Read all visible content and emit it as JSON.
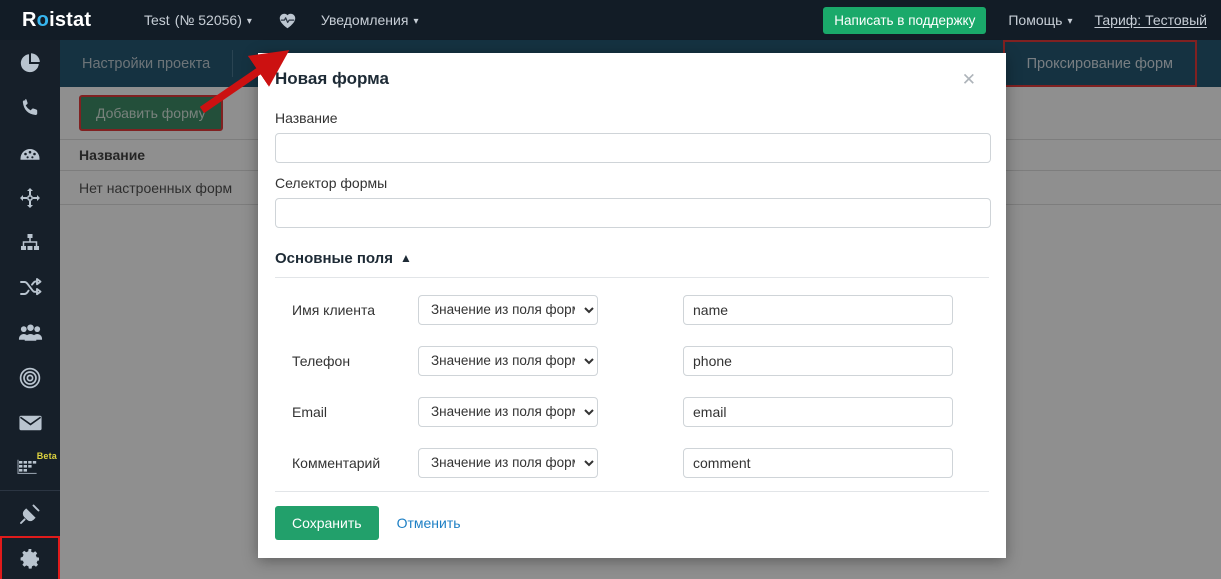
{
  "topbar": {
    "logo_text_before": "R",
    "logo_dot": "o",
    "logo_text_after": "istat",
    "project": "Test",
    "project_number": "(№ 52056)",
    "pulse_icon": "heartbeat-icon",
    "notifications": "Уведомления",
    "support_button": "Написать в поддержку",
    "help": "Помощь",
    "tariff": "Тариф: Тестовый",
    "accent_green": "#1aa96a",
    "bar_color": "#121c26"
  },
  "sidebar": {
    "items": [
      {
        "name": "analytics",
        "icon": "pie-chart-icon"
      },
      {
        "name": "calls",
        "icon": "phone-icon"
      },
      {
        "name": "dashboard",
        "icon": "gauge-icon"
      },
      {
        "name": "multichannel",
        "icon": "arrows-move-icon"
      },
      {
        "name": "funnel",
        "icon": "sitemap-icon"
      },
      {
        "name": "distribution",
        "icon": "shuffle-icon"
      },
      {
        "name": "leads",
        "icon": "users-icon"
      },
      {
        "name": "targets",
        "icon": "target-icon"
      },
      {
        "name": "mail",
        "icon": "envelope-icon"
      },
      {
        "name": "tables",
        "icon": "table-grid-icon",
        "badge": "Beta"
      },
      {
        "name": "integrations",
        "icon": "plug-icon"
      },
      {
        "name": "settings",
        "icon": "gear-icon",
        "highlighted": true
      }
    ],
    "highlight_color": "#e01b1b"
  },
  "subnav": {
    "project_settings": "Настройки проекта",
    "forms_proxy_tab": "Проксирование форм",
    "bar_color": "#023e5c"
  },
  "page": {
    "add_form_button": "Добавить форму",
    "table": {
      "columns": [
        "Название"
      ],
      "rows": [
        [
          "Нет настроенных форм"
        ]
      ]
    }
  },
  "modal": {
    "title": "Новая форма",
    "close_icon": "close-icon",
    "name_label": "Название",
    "name_value": "",
    "name_placeholder": "",
    "selector_label": "Селектор формы",
    "selector_value": "",
    "selector_placeholder": "",
    "section_title": "Основные поля",
    "section_chevron": "⌃",
    "select_option": "Значение из поля формы",
    "fields": [
      {
        "label": "Имя клиента",
        "source": "Значение из поля формы",
        "value": "name"
      },
      {
        "label": "Телефон",
        "source": "Значение из поля формы",
        "value": "phone"
      },
      {
        "label": "Email",
        "source": "Значение из поля формы",
        "value": "email"
      },
      {
        "label": "Комментарий",
        "source": "Значение из поля формы",
        "value": "comment"
      }
    ],
    "save_button": "Сохранить",
    "cancel_button": "Отменить",
    "save_color": "#22a06b",
    "cancel_color": "#1d7fc4"
  },
  "annotation": {
    "arrow_color": "#cc1111",
    "description": "arrow from add-form button to modal title"
  }
}
